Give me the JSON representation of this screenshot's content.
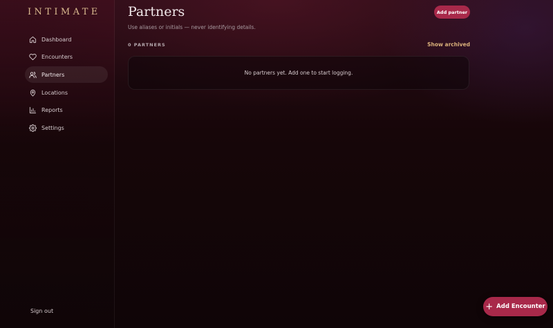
{
  "brand": "INTIMATE",
  "sidebar": {
    "items": [
      {
        "label": "Dashboard",
        "icon": "home-icon",
        "active": false
      },
      {
        "label": "Encounters",
        "icon": "heart-icon",
        "active": false
      },
      {
        "label": "Partners",
        "icon": "users-icon",
        "active": true
      },
      {
        "label": "Locations",
        "icon": "map-pin-icon",
        "active": false
      },
      {
        "label": "Reports",
        "icon": "bar-chart-icon",
        "active": false
      },
      {
        "label": "Settings",
        "icon": "gear-icon",
        "active": false
      }
    ],
    "sign_out": "Sign out"
  },
  "page": {
    "title": "Partners",
    "subtitle": "Use aliases or initials — never identifying details.",
    "add_button": "Add partner",
    "count_label": "0 PARTNERS",
    "show_archived": "Show archived",
    "empty_message": "No partners yet. Add one to start logging."
  },
  "fab": {
    "label": "Add Encounter",
    "icon": "plus-icon"
  },
  "colors": {
    "accent": "#a8294a",
    "gold": "#d9b98f",
    "link": "#d9b07a",
    "background": "#120508"
  }
}
